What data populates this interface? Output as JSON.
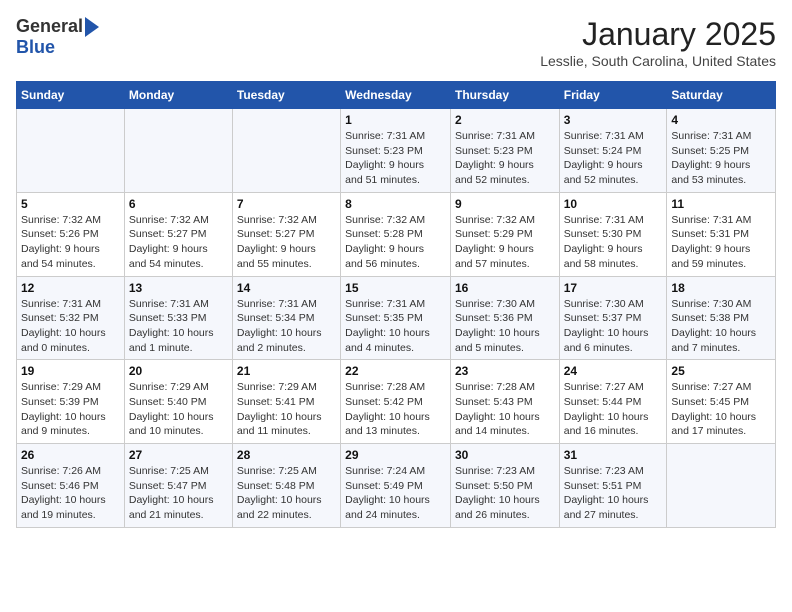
{
  "logo": {
    "general": "General",
    "blue": "Blue"
  },
  "title": "January 2025",
  "location": "Lesslie, South Carolina, United States",
  "days_of_week": [
    "Sunday",
    "Monday",
    "Tuesday",
    "Wednesday",
    "Thursday",
    "Friday",
    "Saturday"
  ],
  "weeks": [
    [
      {
        "day": "",
        "info": ""
      },
      {
        "day": "",
        "info": ""
      },
      {
        "day": "",
        "info": ""
      },
      {
        "day": "1",
        "info": "Sunrise: 7:31 AM\nSunset: 5:23 PM\nDaylight: 9 hours\nand 51 minutes."
      },
      {
        "day": "2",
        "info": "Sunrise: 7:31 AM\nSunset: 5:23 PM\nDaylight: 9 hours\nand 52 minutes."
      },
      {
        "day": "3",
        "info": "Sunrise: 7:31 AM\nSunset: 5:24 PM\nDaylight: 9 hours\nand 52 minutes."
      },
      {
        "day": "4",
        "info": "Sunrise: 7:31 AM\nSunset: 5:25 PM\nDaylight: 9 hours\nand 53 minutes."
      }
    ],
    [
      {
        "day": "5",
        "info": "Sunrise: 7:32 AM\nSunset: 5:26 PM\nDaylight: 9 hours\nand 54 minutes."
      },
      {
        "day": "6",
        "info": "Sunrise: 7:32 AM\nSunset: 5:27 PM\nDaylight: 9 hours\nand 54 minutes."
      },
      {
        "day": "7",
        "info": "Sunrise: 7:32 AM\nSunset: 5:27 PM\nDaylight: 9 hours\nand 55 minutes."
      },
      {
        "day": "8",
        "info": "Sunrise: 7:32 AM\nSunset: 5:28 PM\nDaylight: 9 hours\nand 56 minutes."
      },
      {
        "day": "9",
        "info": "Sunrise: 7:32 AM\nSunset: 5:29 PM\nDaylight: 9 hours\nand 57 minutes."
      },
      {
        "day": "10",
        "info": "Sunrise: 7:31 AM\nSunset: 5:30 PM\nDaylight: 9 hours\nand 58 minutes."
      },
      {
        "day": "11",
        "info": "Sunrise: 7:31 AM\nSunset: 5:31 PM\nDaylight: 9 hours\nand 59 minutes."
      }
    ],
    [
      {
        "day": "12",
        "info": "Sunrise: 7:31 AM\nSunset: 5:32 PM\nDaylight: 10 hours\nand 0 minutes."
      },
      {
        "day": "13",
        "info": "Sunrise: 7:31 AM\nSunset: 5:33 PM\nDaylight: 10 hours\nand 1 minute."
      },
      {
        "day": "14",
        "info": "Sunrise: 7:31 AM\nSunset: 5:34 PM\nDaylight: 10 hours\nand 2 minutes."
      },
      {
        "day": "15",
        "info": "Sunrise: 7:31 AM\nSunset: 5:35 PM\nDaylight: 10 hours\nand 4 minutes."
      },
      {
        "day": "16",
        "info": "Sunrise: 7:30 AM\nSunset: 5:36 PM\nDaylight: 10 hours\nand 5 minutes."
      },
      {
        "day": "17",
        "info": "Sunrise: 7:30 AM\nSunset: 5:37 PM\nDaylight: 10 hours\nand 6 minutes."
      },
      {
        "day": "18",
        "info": "Sunrise: 7:30 AM\nSunset: 5:38 PM\nDaylight: 10 hours\nand 7 minutes."
      }
    ],
    [
      {
        "day": "19",
        "info": "Sunrise: 7:29 AM\nSunset: 5:39 PM\nDaylight: 10 hours\nand 9 minutes."
      },
      {
        "day": "20",
        "info": "Sunrise: 7:29 AM\nSunset: 5:40 PM\nDaylight: 10 hours\nand 10 minutes."
      },
      {
        "day": "21",
        "info": "Sunrise: 7:29 AM\nSunset: 5:41 PM\nDaylight: 10 hours\nand 11 minutes."
      },
      {
        "day": "22",
        "info": "Sunrise: 7:28 AM\nSunset: 5:42 PM\nDaylight: 10 hours\nand 13 minutes."
      },
      {
        "day": "23",
        "info": "Sunrise: 7:28 AM\nSunset: 5:43 PM\nDaylight: 10 hours\nand 14 minutes."
      },
      {
        "day": "24",
        "info": "Sunrise: 7:27 AM\nSunset: 5:44 PM\nDaylight: 10 hours\nand 16 minutes."
      },
      {
        "day": "25",
        "info": "Sunrise: 7:27 AM\nSunset: 5:45 PM\nDaylight: 10 hours\nand 17 minutes."
      }
    ],
    [
      {
        "day": "26",
        "info": "Sunrise: 7:26 AM\nSunset: 5:46 PM\nDaylight: 10 hours\nand 19 minutes."
      },
      {
        "day": "27",
        "info": "Sunrise: 7:25 AM\nSunset: 5:47 PM\nDaylight: 10 hours\nand 21 minutes."
      },
      {
        "day": "28",
        "info": "Sunrise: 7:25 AM\nSunset: 5:48 PM\nDaylight: 10 hours\nand 22 minutes."
      },
      {
        "day": "29",
        "info": "Sunrise: 7:24 AM\nSunset: 5:49 PM\nDaylight: 10 hours\nand 24 minutes."
      },
      {
        "day": "30",
        "info": "Sunrise: 7:23 AM\nSunset: 5:50 PM\nDaylight: 10 hours\nand 26 minutes."
      },
      {
        "day": "31",
        "info": "Sunrise: 7:23 AM\nSunset: 5:51 PM\nDaylight: 10 hours\nand 27 minutes."
      },
      {
        "day": "",
        "info": ""
      }
    ]
  ]
}
